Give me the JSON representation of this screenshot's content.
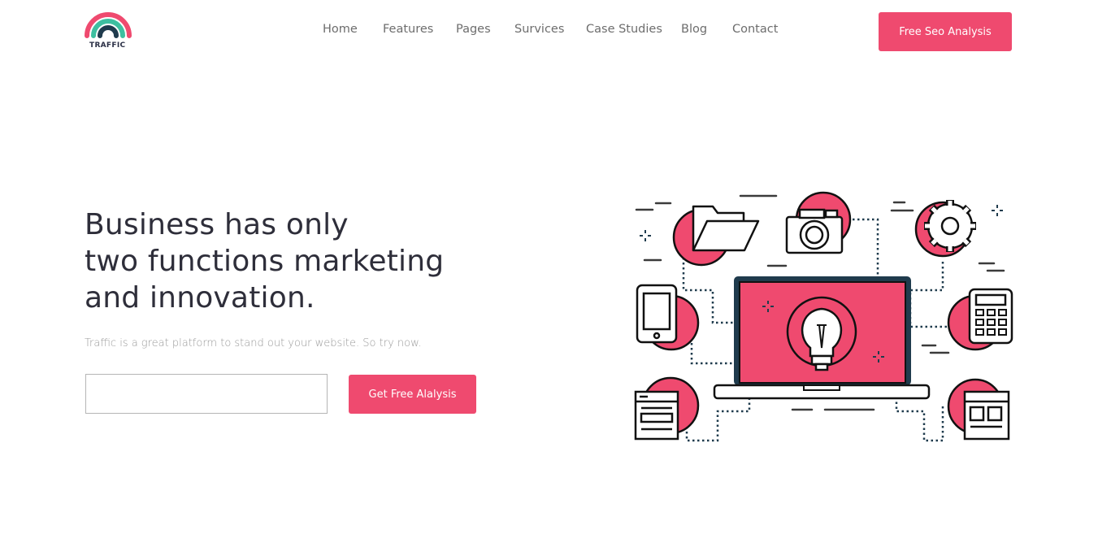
{
  "brand": {
    "name": "TRAFFIC",
    "colors": {
      "pink": "#ef4a6f",
      "teal": "#3dbfa0",
      "navy": "#1f3b4d"
    }
  },
  "nav": {
    "items": [
      {
        "label": "Home"
      },
      {
        "label": "Features"
      },
      {
        "label": "Pages"
      },
      {
        "label": "Survices"
      },
      {
        "label": "Case Studies"
      },
      {
        "label": "Blog"
      },
      {
        "label": "Contact"
      }
    ],
    "cta_label": "Free Seo Analysis"
  },
  "hero": {
    "title_lines": [
      "Business has only",
      "two functions marketing",
      "and innovation."
    ],
    "subtitle": "Traffic is a great platform to stand out your website. So try now.",
    "input_value": "",
    "button_label": "Get Free Alalysis"
  },
  "illustration": {
    "icons": [
      "folder-icon",
      "camera-icon",
      "gear-icon",
      "phone-icon",
      "calculator-icon",
      "browser-window-icon",
      "layout-window-icon",
      "laptop-icon",
      "lightbulb-icon"
    ]
  }
}
